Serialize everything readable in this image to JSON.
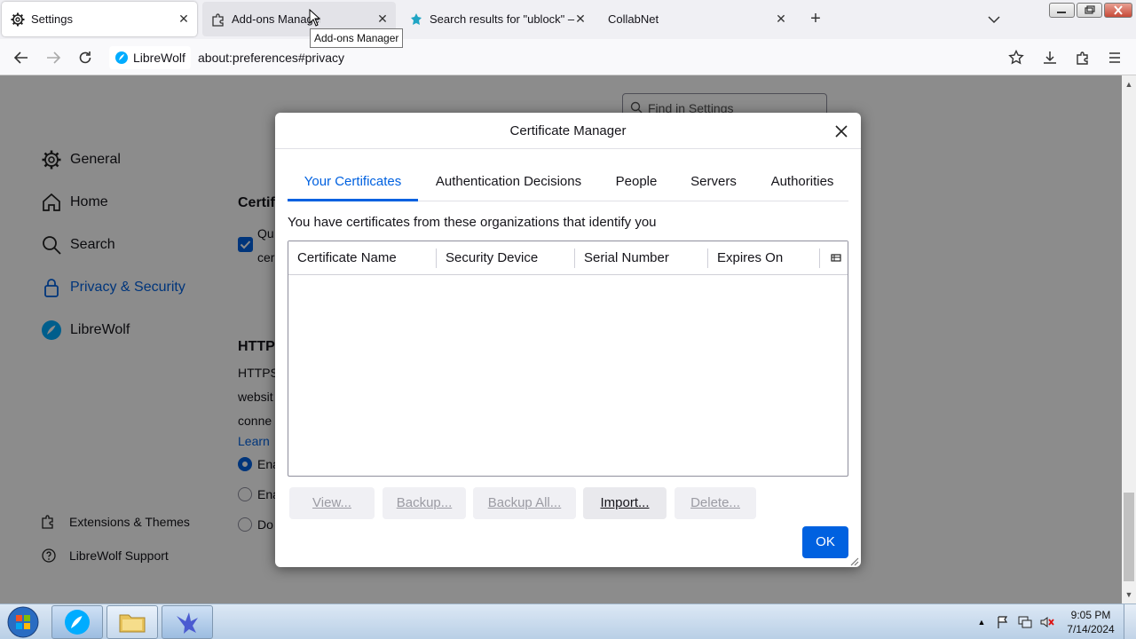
{
  "browser": {
    "tabs": [
      {
        "title": "Settings",
        "icon": "gear-icon",
        "state": "active"
      },
      {
        "title": "Add-ons Manager",
        "icon": "puzzle-icon",
        "state": "hover"
      },
      {
        "title": "Search results for \"ublock\" – Ad",
        "icon": "addons-site-icon",
        "state": "normal"
      },
      {
        "title": "CollabNet",
        "icon": "none",
        "state": "normal"
      }
    ],
    "tooltip": "Add-ons Manager",
    "identity_label": "LibreWolf",
    "url": "about:preferences#privacy"
  },
  "settings_page": {
    "find_placeholder": "Find in Settings",
    "nav": [
      {
        "label": "General",
        "icon": "gear-icon"
      },
      {
        "label": "Home",
        "icon": "home-icon"
      },
      {
        "label": "Search",
        "icon": "search-icon"
      },
      {
        "label": "Privacy & Security",
        "icon": "lock-icon",
        "selected": true
      },
      {
        "label": "LibreWolf",
        "icon": "librewolf-icon"
      }
    ],
    "footer_nav": [
      {
        "label": "Extensions & Themes",
        "icon": "puzzle-icon"
      },
      {
        "label": "LibreWolf Support",
        "icon": "help-icon"
      }
    ],
    "fragments": {
      "certif": "Certif",
      "qu": "Qu",
      "cer": "cer",
      "https": "HTTPS",
      "https_text": "HTTPS",
      "websit": "websit",
      "conne": "conne",
      "learn": "Learn",
      "ena1": "Ena",
      "ena2": "Ena",
      "do": "Do"
    }
  },
  "dialog": {
    "title": "Certificate Manager",
    "tabs": [
      "Your Certificates",
      "Authentication Decisions",
      "People",
      "Servers",
      "Authorities"
    ],
    "active_tab": "Your Certificates",
    "intro": "You have certificates from these organizations that identify you",
    "columns": [
      "Certificate Name",
      "Security Device",
      "Serial Number",
      "Expires On"
    ],
    "buttons": {
      "view": "View...",
      "backup": "Backup...",
      "backup_all": "Backup All...",
      "import": "Import...",
      "delete": "Delete...",
      "ok": "OK"
    }
  },
  "taskbar": {
    "time": "9:05 PM",
    "date": "7/14/2024"
  },
  "colors": {
    "accent": "#0061e0",
    "tabstrip": "#f0f0f4"
  }
}
